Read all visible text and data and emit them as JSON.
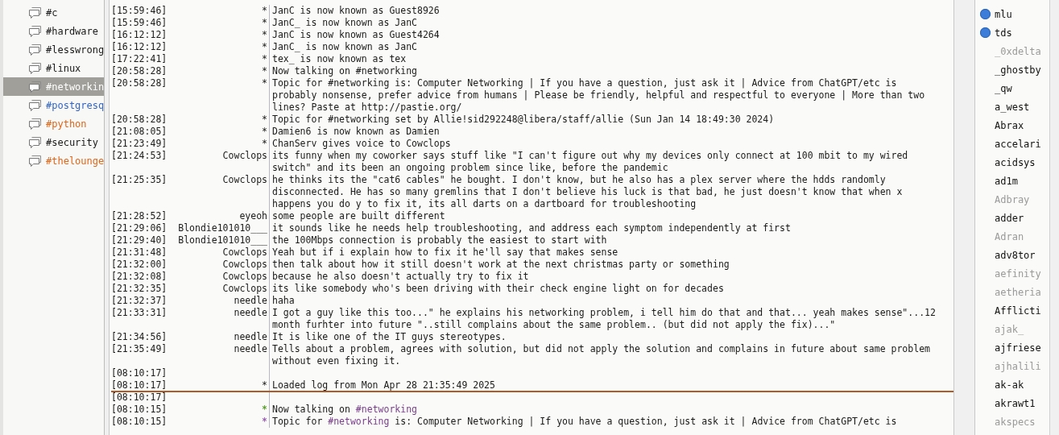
{
  "channels": [
    {
      "name": "#c",
      "selected": false,
      "new_data": false,
      "new_message": false
    },
    {
      "name": "#hardware",
      "selected": false,
      "new_data": false,
      "new_message": false
    },
    {
      "name": "#lesswrong",
      "selected": false,
      "new_data": false,
      "new_message": false
    },
    {
      "name": "#linux",
      "selected": false,
      "new_data": false,
      "new_message": false
    },
    {
      "name": "#networkin",
      "selected": true,
      "new_data": false,
      "new_message": false
    },
    {
      "name": "#postgresq",
      "selected": false,
      "new_data": true,
      "new_message": false
    },
    {
      "name": "#python",
      "selected": false,
      "new_data": false,
      "new_message": true
    },
    {
      "name": "#security",
      "selected": false,
      "new_data": false,
      "new_message": false
    },
    {
      "name": "#thelounge",
      "selected": false,
      "new_data": false,
      "new_message": true
    }
  ],
  "chat": [
    {
      "kind": "line",
      "time": "[15:59:46]",
      "nick": "*",
      "segments": [
        {
          "text": "JanC is now known as Guest8926"
        }
      ]
    },
    {
      "kind": "line",
      "time": "[15:59:46]",
      "nick": "*",
      "segments": [
        {
          "text": "JanC_ is now known as JanC"
        }
      ]
    },
    {
      "kind": "line",
      "time": "[16:12:12]",
      "nick": "*",
      "segments": [
        {
          "text": "JanC is now known as Guest4264"
        }
      ]
    },
    {
      "kind": "line",
      "time": "[16:12:12]",
      "nick": "*",
      "segments": [
        {
          "text": "JanC_ is now known as JanC"
        }
      ]
    },
    {
      "kind": "line",
      "time": "[17:22:41]",
      "nick": "*",
      "segments": [
        {
          "text": "tex_ is now known as tex"
        }
      ]
    },
    {
      "kind": "line",
      "time": "[20:58:28]",
      "nick": "*",
      "segments": [
        {
          "text": "Now talking on #networking"
        }
      ]
    },
    {
      "kind": "line",
      "time": "[20:58:28]",
      "nick": "*",
      "segments": [
        {
          "text": "Topic for #networking is: Computer Networking | If you have a question, just ask it | Advice from ChatGPT/etc is probably nonsense, prefer advice from humans | Please be friendly, helpful and respectful to everyone | More than two lines? Paste at http://pastie.org/"
        }
      ]
    },
    {
      "kind": "line",
      "time": "[20:58:28]",
      "nick": "*",
      "segments": [
        {
          "text": "Topic for #networking set by Allie!sid292248@libera/staff/allie (Sun Jan 14 18:49:30 2024)"
        }
      ]
    },
    {
      "kind": "line",
      "time": "[21:08:05]",
      "nick": "*",
      "segments": [
        {
          "text": "Damien6 is now known as Damien"
        }
      ]
    },
    {
      "kind": "line",
      "time": "[21:23:49]",
      "nick": "*",
      "segments": [
        {
          "text": "ChanServ gives voice to Cowclops"
        }
      ]
    },
    {
      "kind": "line",
      "time": "[21:24:53]",
      "nick": "Cowclops",
      "segments": [
        {
          "text": "its funny when my coworker says stuff like \"I can't figure out why my devices only connect at 100 mbit to my wired switch\" and its been an ongoing problem since like, before the pandemic"
        }
      ]
    },
    {
      "kind": "line",
      "time": "[21:25:35]",
      "nick": "Cowclops",
      "segments": [
        {
          "text": "he thinks its the \"cat6 cables\" he bought. I don't know, but he also has a plex server where the hdds randomly disconnected. He has so many gremlins that I don't believe his luck is that bad, he just doesn't know that when x happens you do y to fix it, its all darts on a dartboard for troubleshooting"
        }
      ]
    },
    {
      "kind": "line",
      "time": "[21:28:52]",
      "nick": "eyeoh",
      "segments": [
        {
          "text": "some people are built different"
        }
      ]
    },
    {
      "kind": "line",
      "time": "[21:29:06]",
      "nick": "Blondie101010___",
      "segments": [
        {
          "text": "it sounds like he needs help troubleshooting, and address each symptom independently at first"
        }
      ]
    },
    {
      "kind": "line",
      "time": "[21:29:40]",
      "nick": "Blondie101010___",
      "segments": [
        {
          "text": "the 100Mbps connection is probably the easiest to start with"
        }
      ]
    },
    {
      "kind": "line",
      "time": "[21:31:48]",
      "nick": "Cowclops",
      "segments": [
        {
          "text": "Yeah but if i explain how to fix it he'll say that makes sense"
        }
      ]
    },
    {
      "kind": "line",
      "time": "[21:32:00]",
      "nick": "Cowclops",
      "segments": [
        {
          "text": "then talk about how it still doesn't work at the next christmas party or something"
        }
      ]
    },
    {
      "kind": "line",
      "time": "[21:32:08]",
      "nick": "Cowclops",
      "segments": [
        {
          "text": "because he also doesn't actually try to fix it"
        }
      ]
    },
    {
      "kind": "line",
      "time": "[21:32:35]",
      "nick": "Cowclops",
      "segments": [
        {
          "text": "its like somebody who's been driving with their check engine light on for decades"
        }
      ]
    },
    {
      "kind": "line",
      "time": "[21:32:37]",
      "nick": "needle",
      "segments": [
        {
          "text": "haha"
        }
      ]
    },
    {
      "kind": "line",
      "time": "[21:33:31]",
      "nick": "needle",
      "segments": [
        {
          "text": "I got a guy like this too...\" he explains his networking problem, i tell him do that and that... yeah makes sense\"...12 month furhter into future \"..still complains about the same problem.. (but did not apply the fix)...\""
        }
      ]
    },
    {
      "kind": "line",
      "time": "[21:34:56]",
      "nick": "needle",
      "segments": [
        {
          "text": "It is like one of the IT guys stereotypes."
        }
      ]
    },
    {
      "kind": "line",
      "time": "[21:35:49]",
      "nick": "needle",
      "segments": [
        {
          "text": "Tells about a problem, agrees with solution, but did not apply the solution and complains in future about same problem without even fixing it."
        }
      ]
    },
    {
      "kind": "line",
      "time": "[08:10:17]"
    },
    {
      "kind": "line",
      "time": "[08:10:17]",
      "nick": "*",
      "segments": [
        {
          "text": "Loaded log from Mon Apr 28 21:35:49 2025"
        }
      ]
    },
    {
      "kind": "marker"
    },
    {
      "kind": "line",
      "time": "[08:10:17]"
    },
    {
      "kind": "line",
      "time": "[08:10:15]",
      "nick": "*",
      "color": "#5aa02c",
      "segments": [
        {
          "text": "Now talking on "
        },
        {
          "text": "#networking",
          "color": "#7a3f8c"
        }
      ]
    },
    {
      "kind": "line",
      "time": "[08:10:15]",
      "nick": "*",
      "color": "#9a5fb0",
      "segments": [
        {
          "text": "Topic for "
        },
        {
          "text": "#networking",
          "color": "#7a3f8c"
        },
        {
          "text": " is: Computer Networking | If you have a question, just ask it | Advice from ChatGPT/etc is"
        }
      ]
    }
  ],
  "users": [
    {
      "name": "mlu",
      "voiced": true,
      "away": false
    },
    {
      "name": "tds",
      "voiced": true,
      "away": false
    },
    {
      "name": "_0xdelta",
      "voiced": false,
      "away": true
    },
    {
      "name": "_ghostby",
      "voiced": false,
      "away": false
    },
    {
      "name": "_qw",
      "voiced": false,
      "away": false
    },
    {
      "name": "a_west",
      "voiced": false,
      "away": false
    },
    {
      "name": "Abrax",
      "voiced": false,
      "away": false
    },
    {
      "name": "accelari",
      "voiced": false,
      "away": false
    },
    {
      "name": "acidsys",
      "voiced": false,
      "away": false
    },
    {
      "name": "ad1m",
      "voiced": false,
      "away": false
    },
    {
      "name": "Adbray",
      "voiced": false,
      "away": true
    },
    {
      "name": "adder",
      "voiced": false,
      "away": false
    },
    {
      "name": "Adran",
      "voiced": false,
      "away": true
    },
    {
      "name": "adv8tor",
      "voiced": false,
      "away": false
    },
    {
      "name": "aefinity",
      "voiced": false,
      "away": true
    },
    {
      "name": "aetheria",
      "voiced": false,
      "away": true
    },
    {
      "name": "Afflicti",
      "voiced": false,
      "away": false
    },
    {
      "name": "ajak_",
      "voiced": false,
      "away": true
    },
    {
      "name": "ajfriese",
      "voiced": false,
      "away": false
    },
    {
      "name": "ajhalili",
      "voiced": false,
      "away": true
    },
    {
      "name": "ak-ak",
      "voiced": false,
      "away": false
    },
    {
      "name": "akrawt1",
      "voiced": false,
      "away": false
    },
    {
      "name": "akspecs",
      "voiced": false,
      "away": true
    }
  ]
}
